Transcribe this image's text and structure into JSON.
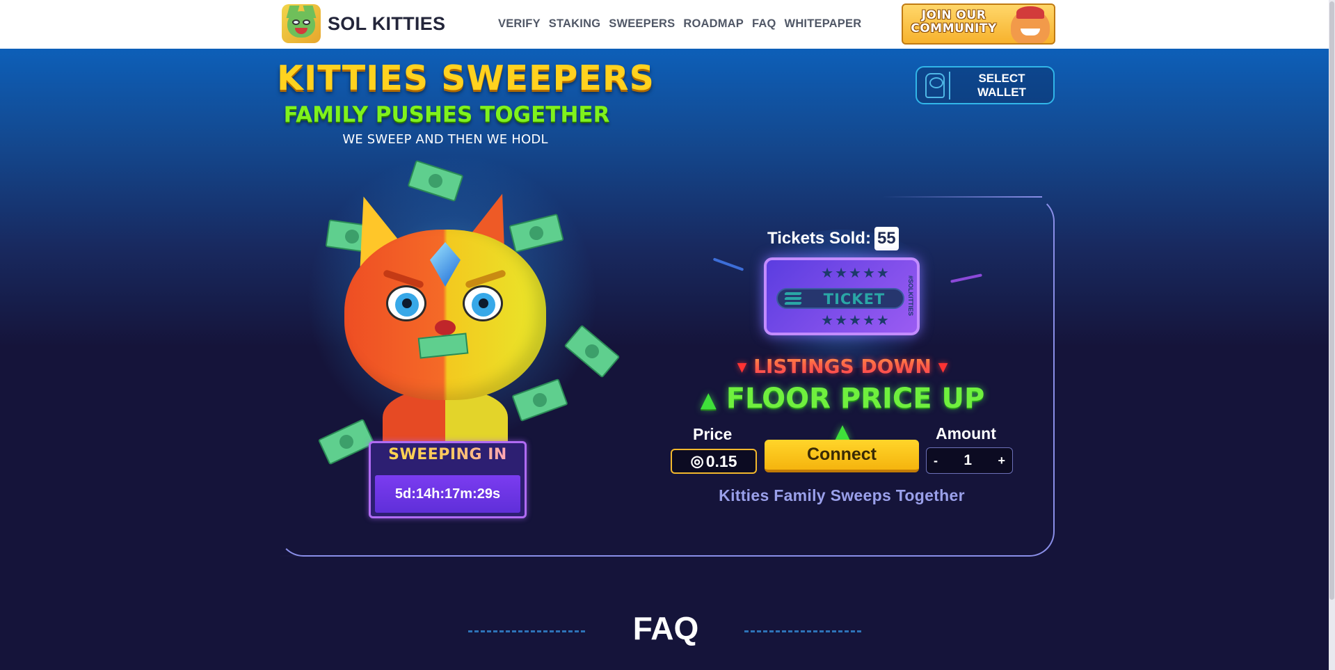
{
  "navbar": {
    "brand_name": "SOL KITTIES",
    "links": [
      "VERIFY",
      "STAKING",
      "SWEEPERS",
      "ROADMAP",
      "FAQ",
      "WHITEPAPER"
    ],
    "community_button": "JOIN OUR\nCOMMUNITY"
  },
  "hero": {
    "title": "KITTIES SWEEPERS",
    "subtitle": "FAMILY PUSHES TOGETHER",
    "tagline": "WE SWEEP AND THEN WE HODL",
    "wallet_button": "SELECT\nWALLET"
  },
  "sweep": {
    "label": "SWEEPING IN",
    "countdown": "5d:14h:17m:29s"
  },
  "tickets": {
    "sold_label": "Tickets Sold:",
    "sold_count": "55",
    "ticket_text": "TICKET",
    "ticket_stars": "★★★★★",
    "ticket_side": "#SOLKITTIES"
  },
  "market": {
    "listings": "LISTINGS DOWN",
    "floor": "FLOOR PRICE UP"
  },
  "purchase": {
    "price_label": "Price",
    "price_symbol": "◎",
    "price_value": "0.15",
    "connect_label": "Connect",
    "amount_label": "Amount",
    "amount_minus": "-",
    "amount_value": "1",
    "amount_plus": "+",
    "footer_text": "Kitties Family Sweeps Together"
  },
  "faq": {
    "title": "FAQ"
  },
  "colors": {
    "accent_yellow": "#ffd21f",
    "accent_green": "#7ff21d",
    "accent_purple": "#9b5cf2",
    "background": "#15143a",
    "card_border": "#8a8fe8"
  }
}
